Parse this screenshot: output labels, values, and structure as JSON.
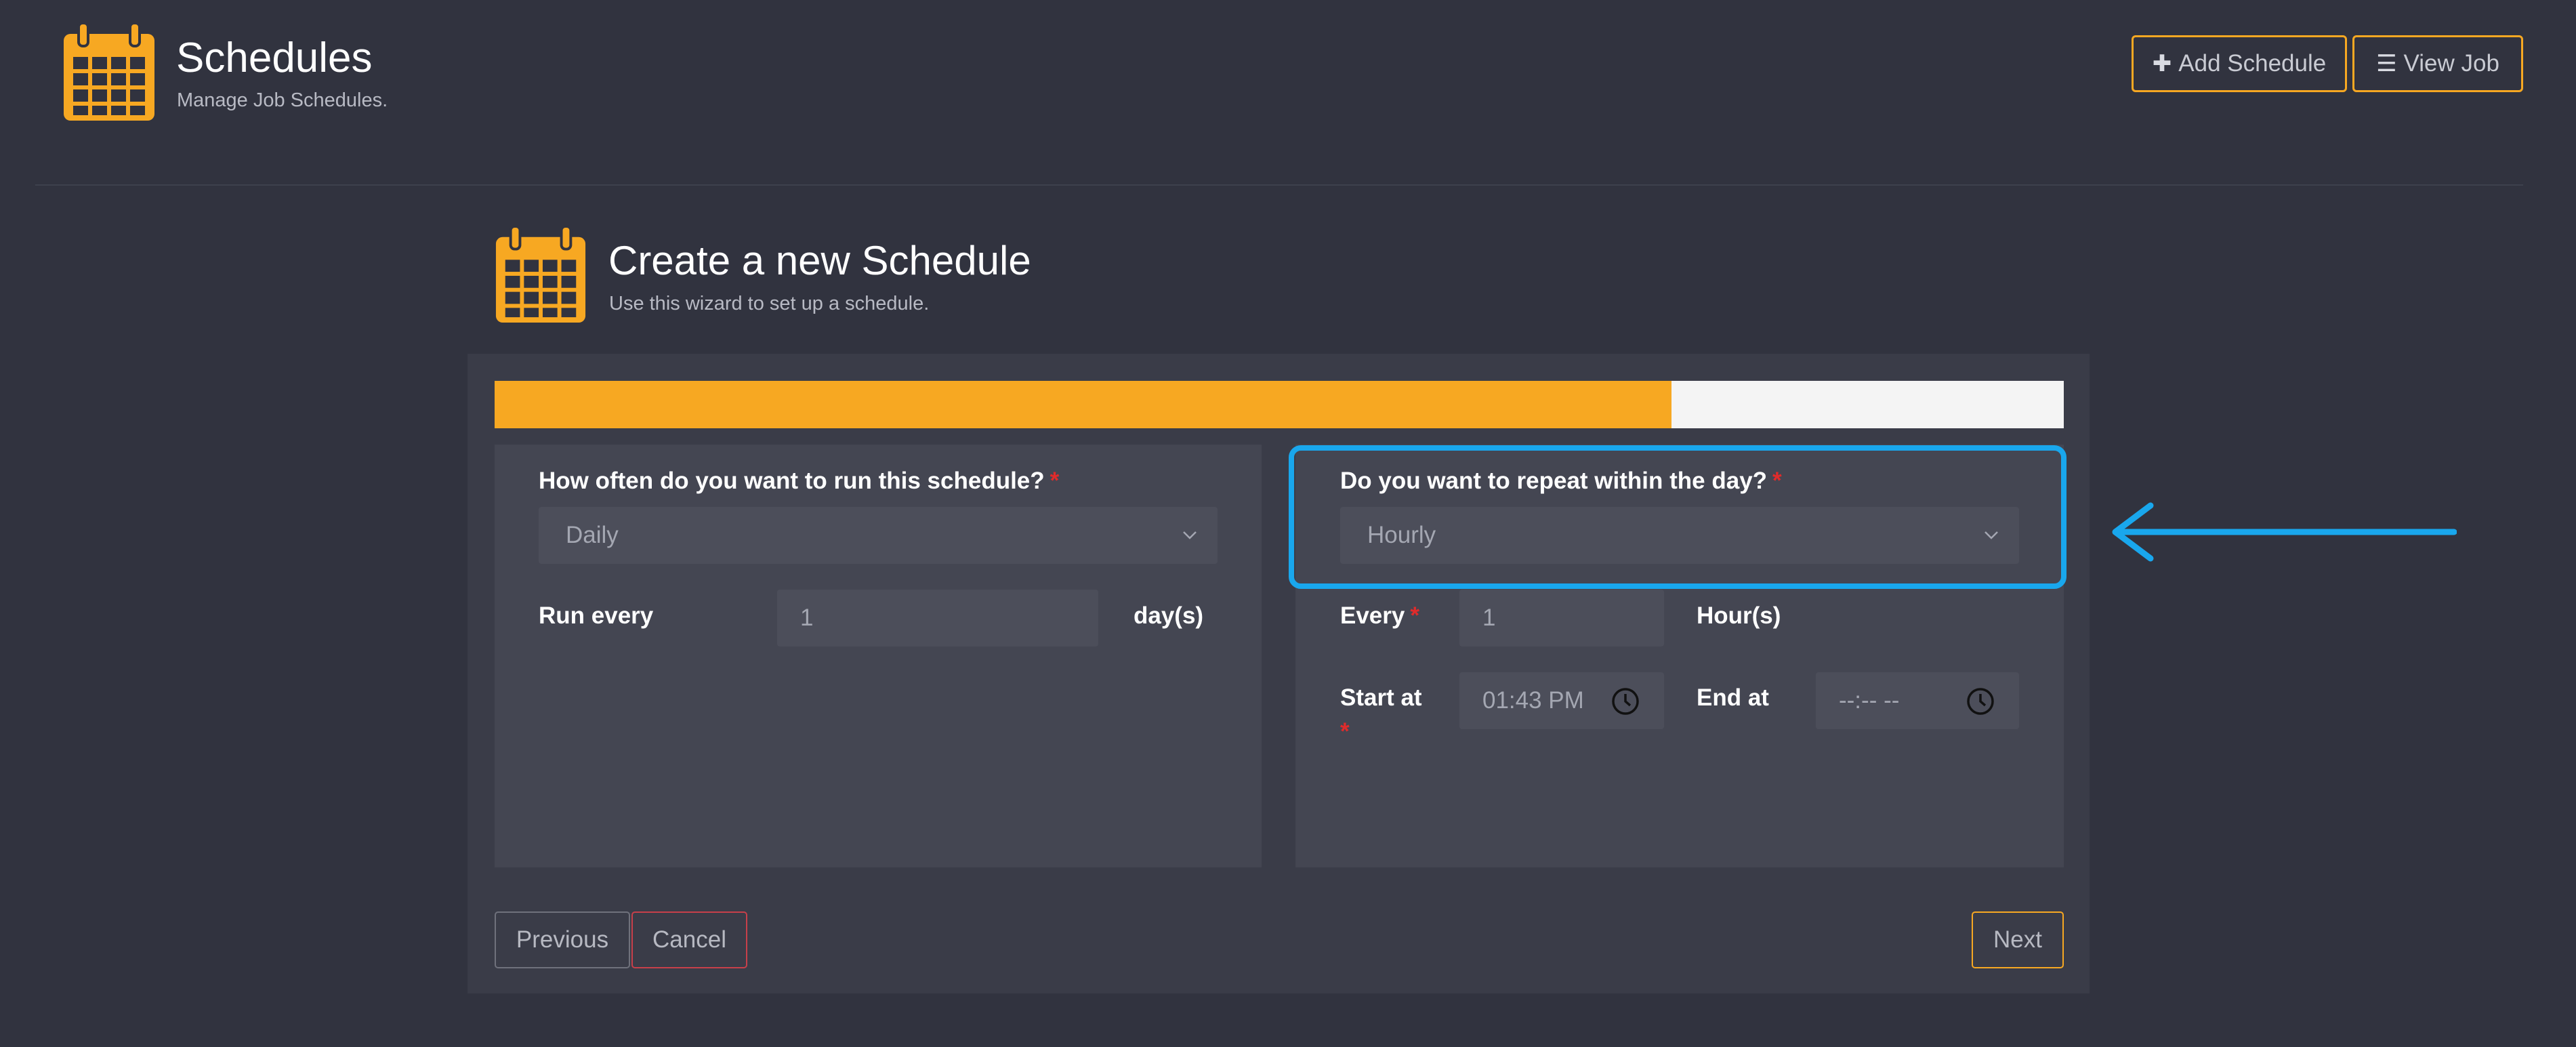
{
  "header": {
    "title": "Schedules",
    "subtitle": "Manage Job Schedules.",
    "icon": "calendar-icon",
    "buttons": {
      "add_schedule": {
        "label": "Add Schedule",
        "icon": "plus-icon"
      },
      "view_job": {
        "label": "View Job",
        "icon": "list-icon"
      }
    }
  },
  "wizard": {
    "title": "Create a new Schedule",
    "subtitle": "Use this wizard to set up a schedule.",
    "icon": "calendar-icon",
    "progress_fraction": 0.75,
    "left_panel": {
      "frequency_label": "How often do you want to run this schedule?",
      "frequency_value": "Daily",
      "run_every_label": "Run every",
      "run_every_value": "1",
      "run_every_unit": "day(s)"
    },
    "right_panel": {
      "repeat_label": "Do you want to repeat within the day?",
      "repeat_value": "Hourly",
      "every_label": "Every",
      "every_value": "1",
      "every_unit": "Hour(s)",
      "start_label": "Start at",
      "start_value": "01:43 PM",
      "end_label": "End at",
      "end_value": "--:-- --"
    },
    "required_mark": "*",
    "footer": {
      "previous_label": "Previous",
      "cancel_label": "Cancel",
      "next_label": "Next"
    }
  },
  "colors": {
    "accent": "#f7a822",
    "highlight": "#19a7ed",
    "danger": "#e02b2b",
    "background": "#31333f"
  }
}
